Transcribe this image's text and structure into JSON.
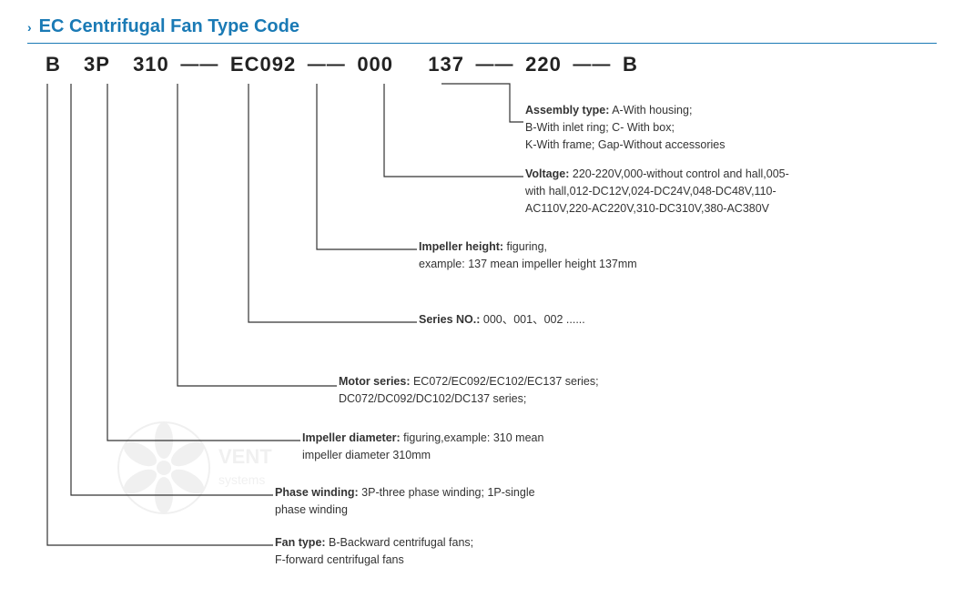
{
  "title": {
    "chevron": "›",
    "label": "EC Centrifugal Fan Type Code"
  },
  "code": {
    "parts": [
      "B",
      "3P",
      "310",
      "EC092",
      "000",
      "137",
      "220",
      "B"
    ],
    "dashes": [
      "—",
      "—",
      "—",
      "—",
      "—",
      "—"
    ]
  },
  "annotations": {
    "assembly": {
      "label": "Assembly type:",
      "text": "A-With housing;\nB-With inlet ring;  C- With box;\nK-With frame; Gap-Without accessories"
    },
    "voltage": {
      "label": "Voltage:",
      "text": "220-220V,000-without control and hall,005-\nwith hall,012-DC12V,024-DC24V,048-DC48V,110-\nAC110V,220-AC220V,310-DC310V,380-AC380V"
    },
    "impeller_height": {
      "label": "Impeller height:",
      "text": "figuring,\nexample: 137 mean impeller height 137mm"
    },
    "series_no": {
      "label": "Series NO.:",
      "text": "000、001、002 ......"
    },
    "motor_series": {
      "label": "Motor series:",
      "text": "EC072/EC092/EC102/EC137 series;\nDC072/DC092/DC102/DC137 series;"
    },
    "impeller_diameter": {
      "label": "Impeller diameter:",
      "text": "figuring,example: 310 mean\nimpeller diameter 310mm"
    },
    "phase_winding": {
      "label": "Phase winding:",
      "text": "3P-three phase winding;  1P-single\nphase winding"
    },
    "fan_type": {
      "label": "Fan type:",
      "text": "B-Backward centrifugal fans;\nF-forward centrifugal fans"
    }
  }
}
